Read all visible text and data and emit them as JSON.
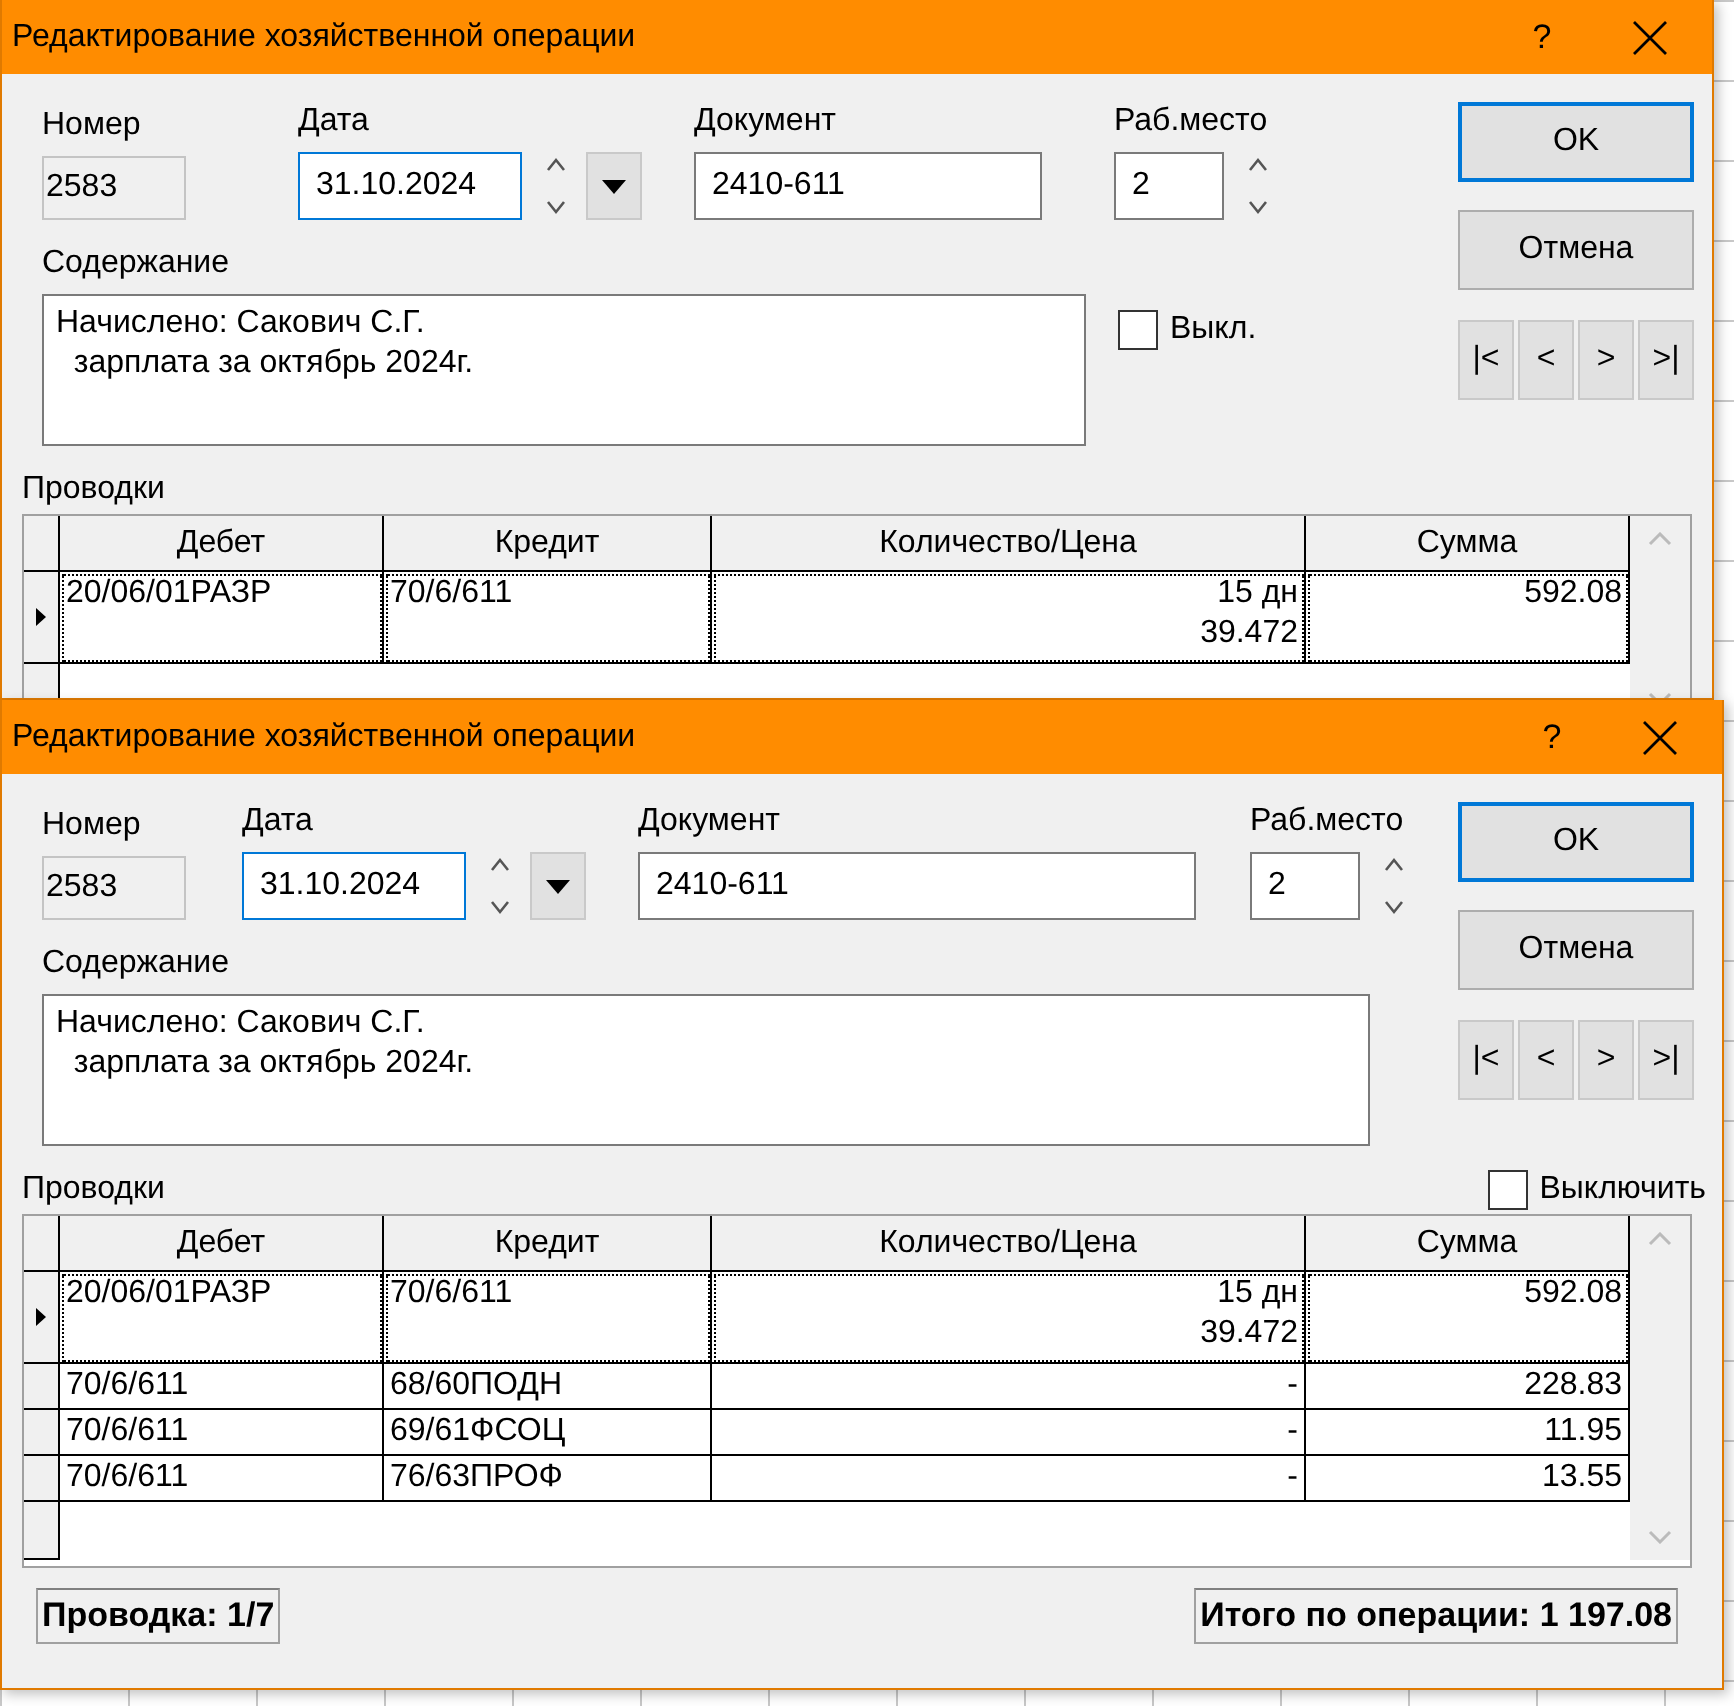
{
  "windows": [
    {
      "kind": "compact",
      "title": "Редактирование хозяйственной операции",
      "help": "?",
      "number": {
        "label": "Номер",
        "value": "2583"
      },
      "date": {
        "label": "Дата",
        "value": "31.10.2024"
      },
      "document": {
        "label": "Документ",
        "value": "2410-611"
      },
      "workplace": {
        "label": "Раб.место",
        "value": "2"
      },
      "content": {
        "label": "Содержание",
        "value": "Начислено: Сакович С.Г.\n  зарплата за октябрь 2024г."
      },
      "switch_off": {
        "label": "Выкл.",
        "checked": false
      },
      "buttons": [
        "OK",
        "Отмена"
      ],
      "nav": [
        "|<",
        "<",
        ">",
        ">|"
      ],
      "postings": {
        "label": "Проводки",
        "columns": [
          "Дебет",
          "Кредит",
          "Количество/Цена",
          "Сумма"
        ],
        "rows": [
          {
            "selected": true,
            "cells": [
              "20/06/01РАЗР",
              "70/6/611",
              "15 дн\n39.472",
              "592.08"
            ]
          }
        ]
      }
    },
    {
      "kind": "wide",
      "title": "Редактирование хозяйственной операции",
      "help": "?",
      "number": {
        "label": "Номер",
        "value": "2583"
      },
      "date": {
        "label": "Дата",
        "value": "31.10.2024"
      },
      "document": {
        "label": "Документ",
        "value": "2410-611"
      },
      "workplace": {
        "label": "Раб.место",
        "value": "2"
      },
      "content": {
        "label": "Содержание",
        "value": "Начислено: Сакович С.Г.\n  зарплата за октябрь 2024г."
      },
      "switch_off": {
        "label": "Выключить",
        "checked": false
      },
      "buttons": [
        "OK",
        "Отмена"
      ],
      "nav": [
        "|<",
        "<",
        ">",
        ">|"
      ],
      "postings": {
        "label": "Проводки",
        "columns": [
          "Дебет",
          "Кредит",
          "Количество/Цена",
          "Сумма"
        ],
        "rows": [
          {
            "selected": true,
            "cells": [
              "20/06/01РАЗР",
              "70/6/611",
              "15 дн\n39.472",
              "592.08"
            ]
          },
          {
            "selected": false,
            "cells": [
              "70/6/611",
              "68/60ПОДН",
              "-",
              "228.83"
            ]
          },
          {
            "selected": false,
            "cells": [
              "70/6/611",
              "69/61ФСОЦ",
              "-",
              "11.95"
            ]
          },
          {
            "selected": false,
            "cells": [
              "70/6/611",
              "76/63ПРОФ",
              "-",
              "13.55"
            ]
          }
        ]
      },
      "footer": {
        "position": "Проводка: 1/7",
        "total": "Итого по операции: 1 197.08"
      }
    }
  ]
}
